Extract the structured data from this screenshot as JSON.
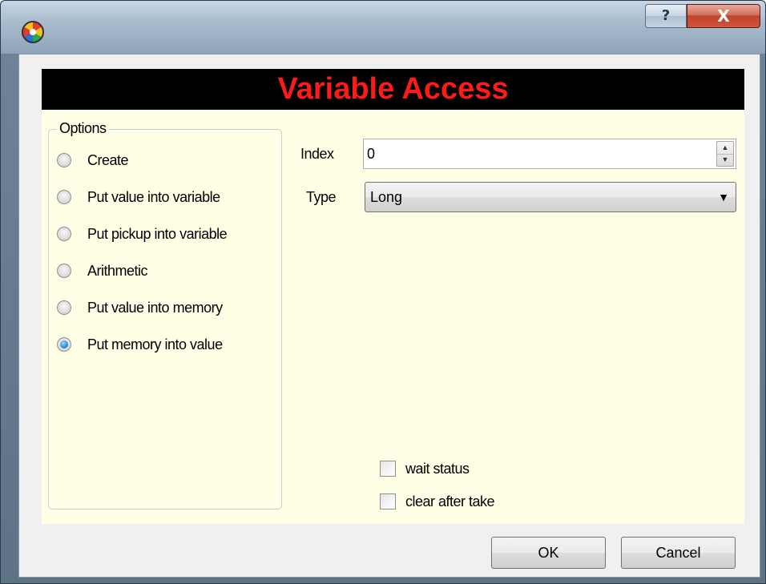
{
  "window": {
    "help_label": "?",
    "close_label": "X",
    "banner_title": "Variable Access",
    "banner_color": "#ff1a1a"
  },
  "options": {
    "legend": "Options",
    "items": [
      {
        "label": "Create",
        "checked": false
      },
      {
        "label": "Put value into variable",
        "checked": false
      },
      {
        "label": "Put pickup into variable",
        "checked": false
      },
      {
        "label": "Arithmetic",
        "checked": false
      },
      {
        "label": "Put value into memory",
        "checked": false
      },
      {
        "label": "Put memory into value",
        "checked": true
      }
    ]
  },
  "fields": {
    "index_label": "Index",
    "index_value": "0",
    "type_label": "Type",
    "type_value": "Long"
  },
  "checks": {
    "wait_status": "wait status",
    "clear_after_take": "clear after take"
  },
  "buttons": {
    "ok": "OK",
    "cancel": "Cancel"
  },
  "colors": {
    "panel_bg": "#ffffe6",
    "radio_selected": "#2d8fe0"
  }
}
